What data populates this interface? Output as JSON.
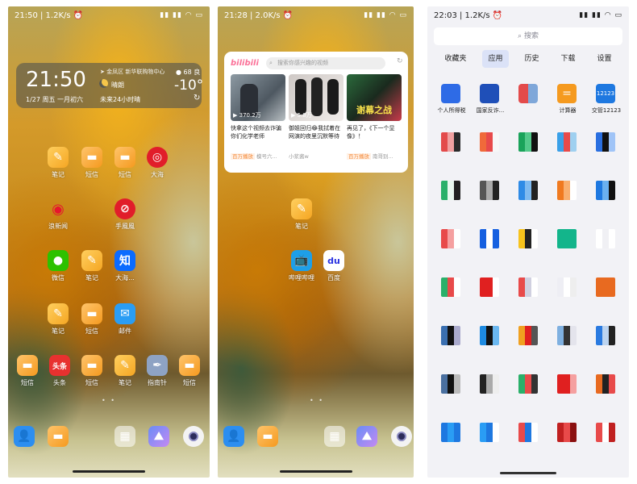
{
  "phone1": {
    "status": {
      "left": "21:50 | 1.2K/s ⏰",
      "right": "▮▮ ▮▮ ◠ ▭"
    },
    "weather": {
      "time": "21:50",
      "date": "1/27 周五 一月初六",
      "location": "➤ 金凤区 新华联购物中心",
      "condition": "晴朗",
      "forecast": "未来24小时晴",
      "aqi": "68 良",
      "temperature": "-10°"
    },
    "apps": [
      {
        "label": "笔记",
        "icon": "note-icon"
      },
      {
        "label": "短信",
        "icon": "sms-icon"
      },
      {
        "label": "短信",
        "icon": "sms-icon"
      },
      {
        "label": "大海",
        "icon": "netease-music-icon"
      },
      {
        "label": "浪新闻",
        "icon": "weibo-icon"
      },
      {
        "label": "手風風",
        "icon": "red-circle-icon"
      },
      {
        "label": "微信",
        "icon": "wechat-icon"
      },
      {
        "label": "笔记",
        "icon": "note-icon"
      },
      {
        "label": "大海...",
        "icon": "zhihu-icon"
      },
      {
        "label": "笔记",
        "icon": "note-icon"
      },
      {
        "label": "短信",
        "icon": "sms-icon"
      },
      {
        "label": "邮件",
        "icon": "mail-icon"
      },
      {
        "label": "短信",
        "icon": "sms-icon"
      },
      {
        "label": "头条",
        "icon": "toutiao-icon"
      },
      {
        "label": "短信",
        "icon": "sms-icon"
      },
      {
        "label": "笔记",
        "icon": "note-icon"
      },
      {
        "label": "指南针",
        "icon": "feather-icon"
      },
      {
        "label": "短信",
        "icon": "sms-icon"
      }
    ],
    "toutiao_text": "头条",
    "zhihu_text": "知",
    "page_dots": "• •"
  },
  "phone2": {
    "status": {
      "left": "21:28 | 2.0K/s ⏰",
      "right": "▮▮ ▮▮ ◠ ▭"
    },
    "bili": {
      "logo": "bilibili",
      "search_placeholder": "搜索你感兴趣的视频",
      "videos": [
        {
          "plays": "370.2万",
          "title": "快拿这个视频去诈骗你们化学老师",
          "badge": "百万播放",
          "author": "模号六..."
        },
        {
          "plays": "5.8万",
          "title": "御姐回归😂我拭着在网演的夜里沉默等待",
          "badge": "",
          "author": "小浆酱w"
        },
        {
          "plays": "",
          "title": "再见了，《下一个显像》！",
          "badge": "百万播放",
          "author": "南哥别..."
        }
      ],
      "thumb3_text": "谢幕之战"
    },
    "apps": [
      {
        "label": "笔记",
        "icon": "note-icon"
      },
      {
        "label": "哔哩哔哩",
        "icon": "bilibili-icon"
      },
      {
        "label": "百度",
        "icon": "baidu-icon"
      }
    ],
    "baidu_text": "du",
    "page_dots": "• •"
  },
  "phone3": {
    "status": {
      "left": "22:03 | 1.2K/s ⏰",
      "right": "▮▮ ▮▮ ◠ ▭"
    },
    "search_label": "搜索",
    "tabs": [
      "收藏夹",
      "应用",
      "历史",
      "下载",
      "设置"
    ],
    "active_tab": "应用",
    "apps": [
      {
        "label": "个人所得税",
        "color": "#2e6be6"
      },
      {
        "label": "国家反诈...",
        "color": "#1f4fb8"
      },
      {
        "label": "",
        "color": "#e34b4b"
      },
      {
        "label": "计算器",
        "color": "#f59a1f"
      },
      {
        "label": "交管12123",
        "color": "#1e78e0"
      }
    ],
    "calc_text": "=",
    "traffic_text": "12123"
  },
  "dock": [
    {
      "icon": "contacts-icon"
    },
    {
      "icon": "messages-icon"
    },
    {
      "icon": "folder-icon"
    },
    {
      "icon": "gallery-icon"
    },
    {
      "icon": "camera-icon"
    }
  ]
}
